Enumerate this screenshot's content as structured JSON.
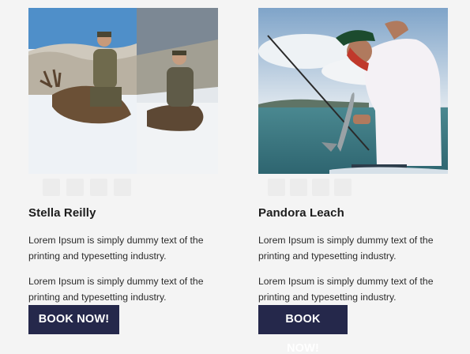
{
  "cards": [
    {
      "name": "Stella Reilly",
      "paragraphs": [
        "Lorem Ipsum is simply dummy text of the printing and typesetting industry.",
        "Lorem Ipsum is simply dummy text of the printing and typesetting industry."
      ],
      "button_label": "BOOK NOW!",
      "photo_icon": "hunting-photo"
    },
    {
      "name": "Pandora Leach",
      "paragraphs": [
        "Lorem Ipsum is simply dummy text of the printing and typesetting industry.",
        "Lorem Ipsum is simply dummy text of the printing and typesetting industry."
      ],
      "button_label": "BOOK NOW!",
      "photo_icon": "fishing-photo"
    }
  ],
  "colors": {
    "background": "#f4f4f4",
    "button": "#25284b",
    "button_text": "#ffffff",
    "text": "#2b2b2b"
  }
}
